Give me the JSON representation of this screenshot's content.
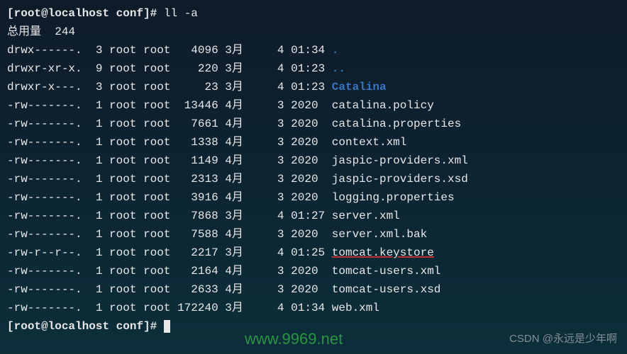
{
  "prompt": {
    "user": "root",
    "host": "localhost",
    "path": "conf",
    "symbol": "#"
  },
  "command": "ll -a",
  "total_label": "总用量",
  "total_value": "244",
  "rows": [
    {
      "perm": "drwx------.",
      "links": "3",
      "owner": "root",
      "group": "root",
      "size": "4096",
      "month": "3月",
      "day": "4",
      "time": "01:34",
      "name": ".",
      "type": "dir"
    },
    {
      "perm": "drwxr-xr-x.",
      "links": "9",
      "owner": "root",
      "group": "root",
      "size": "220",
      "month": "3月",
      "day": "4",
      "time": "01:23",
      "name": "..",
      "type": "dir"
    },
    {
      "perm": "drwxr-x---.",
      "links": "3",
      "owner": "root",
      "group": "root",
      "size": "23",
      "month": "3月",
      "day": "4",
      "time": "01:23",
      "name": "Catalina",
      "type": "dir"
    },
    {
      "perm": "-rw-------.",
      "links": "1",
      "owner": "root",
      "group": "root",
      "size": "13446",
      "month": "4月",
      "day": "3",
      "time": "2020",
      "name": "catalina.policy",
      "type": "file"
    },
    {
      "perm": "-rw-------.",
      "links": "1",
      "owner": "root",
      "group": "root",
      "size": "7661",
      "month": "4月",
      "day": "3",
      "time": "2020",
      "name": "catalina.properties",
      "type": "file"
    },
    {
      "perm": "-rw-------.",
      "links": "1",
      "owner": "root",
      "group": "root",
      "size": "1338",
      "month": "4月",
      "day": "3",
      "time": "2020",
      "name": "context.xml",
      "type": "file"
    },
    {
      "perm": "-rw-------.",
      "links": "1",
      "owner": "root",
      "group": "root",
      "size": "1149",
      "month": "4月",
      "day": "3",
      "time": "2020",
      "name": "jaspic-providers.xml",
      "type": "file"
    },
    {
      "perm": "-rw-------.",
      "links": "1",
      "owner": "root",
      "group": "root",
      "size": "2313",
      "month": "4月",
      "day": "3",
      "time": "2020",
      "name": "jaspic-providers.xsd",
      "type": "file"
    },
    {
      "perm": "-rw-------.",
      "links": "1",
      "owner": "root",
      "group": "root",
      "size": "3916",
      "month": "4月",
      "day": "3",
      "time": "2020",
      "name": "logging.properties",
      "type": "file"
    },
    {
      "perm": "-rw-------.",
      "links": "1",
      "owner": "root",
      "group": "root",
      "size": "7868",
      "month": "3月",
      "day": "4",
      "time": "01:27",
      "name": "server.xml",
      "type": "file"
    },
    {
      "perm": "-rw-------.",
      "links": "1",
      "owner": "root",
      "group": "root",
      "size": "7588",
      "month": "4月",
      "day": "3",
      "time": "2020",
      "name": "server.xml.bak",
      "type": "file"
    },
    {
      "perm": "-rw-r--r--.",
      "links": "1",
      "owner": "root",
      "group": "root",
      "size": "2217",
      "month": "3月",
      "day": "4",
      "time": "01:25",
      "name": "tomcat.keystore",
      "type": "file",
      "highlight": true
    },
    {
      "perm": "-rw-------.",
      "links": "1",
      "owner": "root",
      "group": "root",
      "size": "2164",
      "month": "4月",
      "day": "3",
      "time": "2020",
      "name": "tomcat-users.xml",
      "type": "file"
    },
    {
      "perm": "-rw-------.",
      "links": "1",
      "owner": "root",
      "group": "root",
      "size": "2633",
      "month": "4月",
      "day": "3",
      "time": "2020",
      "name": "tomcat-users.xsd",
      "type": "file"
    },
    {
      "perm": "-rw-------.",
      "links": "1",
      "owner": "root",
      "group": "root",
      "size": "172240",
      "month": "3月",
      "day": "4",
      "time": "01:34",
      "name": "web.xml",
      "type": "file"
    }
  ],
  "watermark_url": "www.9969.net",
  "watermark_csdn": "CSDN @永远是少年啊"
}
